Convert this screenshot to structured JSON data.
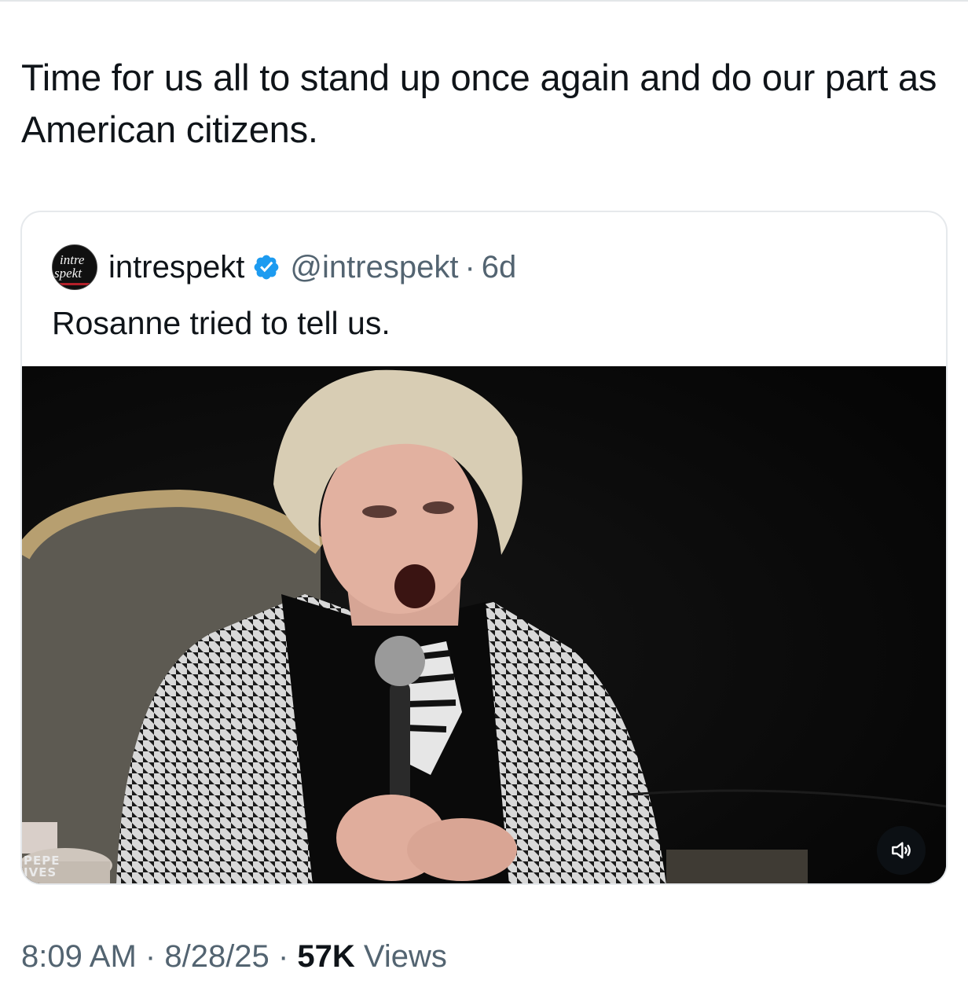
{
  "post": {
    "text": "Time for us all to stand up once again and do our part as American citizens."
  },
  "quoted_post": {
    "avatar_text_line1": "intre",
    "avatar_text_line2": "spekt",
    "author_name": "intrespekt",
    "handle": "@intrespekt",
    "separator": "·",
    "time_ago": "6d",
    "text": "Rosanne tried to tell us.",
    "media": {
      "type": "video",
      "watermark_line1": "PEPE",
      "watermark_line2": "IVES",
      "mute_icon": "speaker-muted-icon"
    }
  },
  "meta": {
    "time": "8:09 AM",
    "separator": "·",
    "date": "8/28/25",
    "views_count": "57K",
    "views_label": "Views"
  },
  "colors": {
    "text_primary": "#0f1419",
    "text_secondary": "#536471",
    "verified_blue": "#1d9bf0",
    "card_border": "#e6e9ec"
  }
}
